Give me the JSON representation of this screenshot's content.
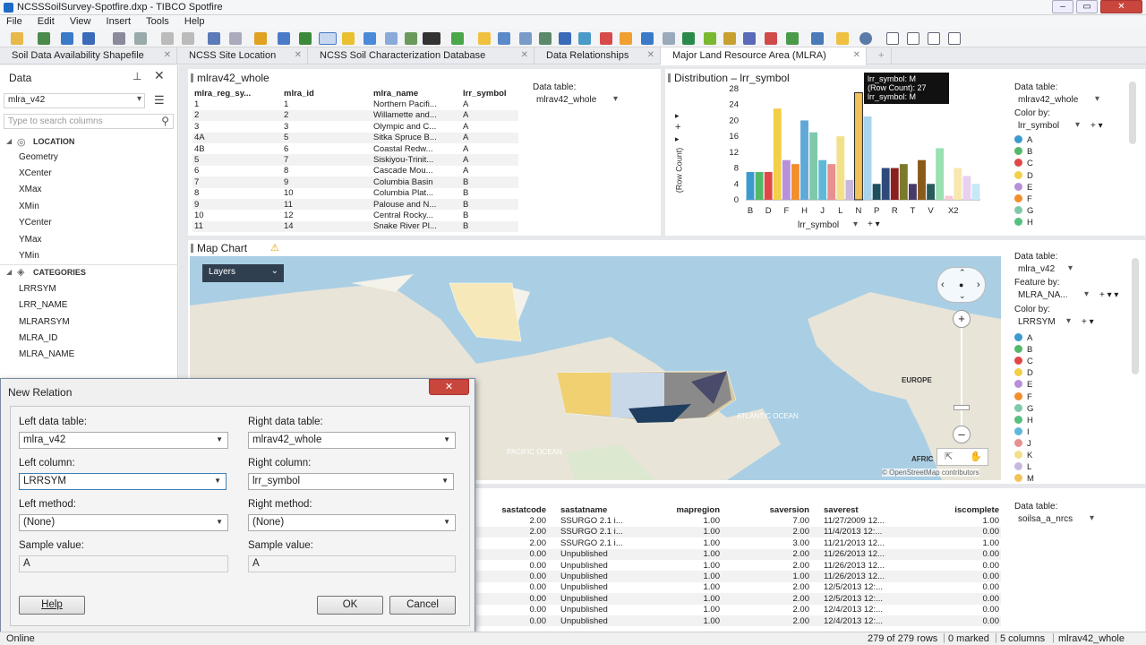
{
  "window": {
    "title": "NCSSSoilSurvey-Spotfire.dxp - TIBCO Spotfire"
  },
  "menu": [
    "File",
    "Edit",
    "View",
    "Insert",
    "Tools",
    "Help"
  ],
  "tabs": [
    {
      "label": "Soil Data Availability Shapefile"
    },
    {
      "label": "NCSS Site Location"
    },
    {
      "label": "NCSS Soil Characterization Database"
    },
    {
      "label": "Data Relationships"
    },
    {
      "label": "Major Land Resource Area (MLRA)"
    }
  ],
  "left": {
    "title": "Data",
    "table": "mlra_v42",
    "search_placeholder": "Type to search columns",
    "cat1": "LOCATION",
    "loc_items": [
      "Geometry",
      "XCenter",
      "XMax",
      "XMin",
      "YCenter",
      "YMax",
      "YMin"
    ],
    "cat2": "CATEGORIES",
    "cat_items": [
      "LRRSYM",
      "LRR_NAME",
      "MLRARSYM",
      "MLRA_ID",
      "MLRA_NAME"
    ]
  },
  "table1": {
    "title": "mlrav42_whole",
    "headers": [
      "mlra_reg_sy...",
      "mlra_id",
      "mlra_name",
      "lrr_symbol"
    ],
    "rows": [
      [
        "1",
        "1",
        "Northern Pacifi...",
        "A"
      ],
      [
        "2",
        "2",
        "Willamette and...",
        "A"
      ],
      [
        "3",
        "3",
        "Olympic and C...",
        "A"
      ],
      [
        "4A",
        "5",
        "Sitka Spruce B...",
        "A"
      ],
      [
        "4B",
        "6",
        "Coastal Redw...",
        "A"
      ],
      [
        "5",
        "7",
        "Siskiyou-Trinit...",
        "A"
      ],
      [
        "6",
        "8",
        "Cascade Mou...",
        "A"
      ],
      [
        "7",
        "9",
        "Columbia Basin",
        "B"
      ],
      [
        "8",
        "10",
        "Columbia Plat...",
        "B"
      ],
      [
        "9",
        "11",
        "Palouse and N...",
        "B"
      ],
      [
        "10",
        "12",
        "Central Rocky...",
        "B"
      ],
      [
        "11",
        "14",
        "Snake River Pl...",
        "B"
      ]
    ],
    "data_table_label": "Data table:",
    "data_table": "mlrav42_whole"
  },
  "dist": {
    "title": "Distribution – lrr_symbol",
    "tooltip": [
      "lrr_symbol: M",
      "(Row Count): 27",
      "lrr_symbol: M"
    ],
    "ylabel": "(Row Count)",
    "xaxis_selector": "lrr_symbol",
    "data_table_label": "Data table:",
    "data_table": "mlrav42_whole",
    "color_by_label": "Color by:",
    "color_by": "lrr_symbol",
    "legend": [
      {
        "name": "A",
        "color": "#3d9ad1"
      },
      {
        "name": "B",
        "color": "#52b86a"
      },
      {
        "name": "C",
        "color": "#e04848"
      },
      {
        "name": "D",
        "color": "#f2cf48"
      },
      {
        "name": "E",
        "color": "#b88fd9"
      },
      {
        "name": "F",
        "color": "#f28e2b"
      },
      {
        "name": "G",
        "color": "#7fc8a9"
      },
      {
        "name": "H",
        "color": "#56c080"
      }
    ]
  },
  "chart_data": {
    "type": "bar",
    "x_tick_labels": [
      "B",
      "D",
      "F",
      "H",
      "J",
      "L",
      "N",
      "P",
      "R",
      "T",
      "V",
      "X2"
    ],
    "ylabel": "(Row Count)",
    "y_ticks": [
      0,
      4,
      8,
      12,
      16,
      20,
      24,
      28
    ],
    "ylim": [
      0,
      28
    ],
    "values": [
      7,
      7,
      7,
      23,
      10,
      9,
      20,
      17,
      10,
      9,
      16,
      5,
      27,
      21,
      4,
      8,
      8,
      9,
      4,
      10,
      4,
      13,
      1,
      8,
      6,
      4
    ],
    "colors": [
      "#3d9ad1",
      "#52b86a",
      "#e04848",
      "#f2cf48",
      "#b88fd9",
      "#f28e2b",
      "#5fa8d8",
      "#7fc8a9",
      "#5fb8d8",
      "#e88f8f",
      "#f3e08a",
      "#c8b8e0",
      "#f2c25a",
      "#a8d4ec",
      "#1f4e5f",
      "#2e4a7a",
      "#8a2020",
      "#7a7a2a",
      "#4a3a6a",
      "#8a5a1a",
      "#2a5a5a",
      "#9ae0b0",
      "#f8c8d8",
      "#f8e8b0",
      "#e8d0f0",
      "#c8e8f8"
    ],
    "grid": false,
    "legend_position": "right"
  },
  "map": {
    "title": "Map Chart",
    "layers_label": "Layers",
    "labels": {
      "europe": "EUROPE",
      "atlantic": "ATLANTIC OCEAN",
      "pacific": "PACIFIC OCEAN",
      "africa": "AFRIC"
    },
    "attribution": "© OpenStreetMap contributors",
    "data_table_label": "Data table:",
    "data_table": "mlra_v42",
    "feature_by_label": "Feature by:",
    "feature_by": "MLRA_NA...",
    "color_by_label": "Color by:",
    "color_by": "LRRSYM",
    "legend": [
      {
        "name": "A",
        "color": "#3d9ad1"
      },
      {
        "name": "B",
        "color": "#52b86a"
      },
      {
        "name": "C",
        "color": "#e04848"
      },
      {
        "name": "D",
        "color": "#f2cf48"
      },
      {
        "name": "E",
        "color": "#b88fd9"
      },
      {
        "name": "F",
        "color": "#f28e2b"
      },
      {
        "name": "G",
        "color": "#7fc8a9"
      },
      {
        "name": "H",
        "color": "#56c080"
      },
      {
        "name": "I",
        "color": "#5fb8d8"
      },
      {
        "name": "J",
        "color": "#e88f8f"
      },
      {
        "name": "K",
        "color": "#f3e08a"
      },
      {
        "name": "L",
        "color": "#c8b8e0"
      },
      {
        "name": "M",
        "color": "#f2c25a"
      }
    ]
  },
  "table2": {
    "headers": [
      "sastatcode",
      "sastatname",
      "mapregion",
      "saversion",
      "saverest",
      "iscomplete"
    ],
    "rows": [
      [
        "2.00",
        "SSURGO 2.1 i...",
        "1.00",
        "7.00",
        "11/27/2009 12...",
        "1.00"
      ],
      [
        "2.00",
        "SSURGO 2.1 i...",
        "1.00",
        "2.00",
        "11/4/2013 12:...",
        "0.00"
      ],
      [
        "2.00",
        "SSURGO 2.1 i...",
        "1.00",
        "3.00",
        "11/21/2013 12...",
        "1.00"
      ],
      [
        "0.00",
        "Unpublished",
        "1.00",
        "2.00",
        "11/26/2013 12...",
        "0.00"
      ],
      [
        "0.00",
        "Unpublished",
        "1.00",
        "2.00",
        "11/26/2013 12...",
        "0.00"
      ],
      [
        "0.00",
        "Unpublished",
        "1.00",
        "1.00",
        "11/26/2013 12...",
        "0.00"
      ],
      [
        "0.00",
        "Unpublished",
        "1.00",
        "2.00",
        "12/5/2013 12:...",
        "0.00"
      ],
      [
        "0.00",
        "Unpublished",
        "1.00",
        "2.00",
        "12/5/2013 12:...",
        "0.00"
      ],
      [
        "0.00",
        "Unpublished",
        "1.00",
        "2.00",
        "12/4/2013 12:...",
        "0.00"
      ],
      [
        "0.00",
        "Unpublished",
        "1.00",
        "2.00",
        "12/4/2013 12:...",
        "0.00"
      ]
    ],
    "data_table_label": "Data table:",
    "data_table": "soilsa_a_nrcs"
  },
  "dialog": {
    "title": "New Relation",
    "left_table_label": "Left data table:",
    "left_table": "mlra_v42",
    "right_table_label": "Right data table:",
    "right_table": "mlrav42_whole",
    "left_col_label": "Left column:",
    "left_col": "LRRSYM",
    "right_col_label": "Right column:",
    "right_col": "lrr_symbol",
    "left_method_label": "Left method:",
    "left_method": "(None)",
    "right_method_label": "Right method:",
    "right_method": "(None)",
    "sample_label": "Sample value:",
    "left_sample": "A",
    "right_sample": "A",
    "help": "Help",
    "ok": "OK",
    "cancel": "Cancel"
  },
  "status": {
    "left": "Online",
    "rows": "279 of 279 rows",
    "marked": "0 marked",
    "columns": "5 columns",
    "table": "mlrav42_whole"
  }
}
